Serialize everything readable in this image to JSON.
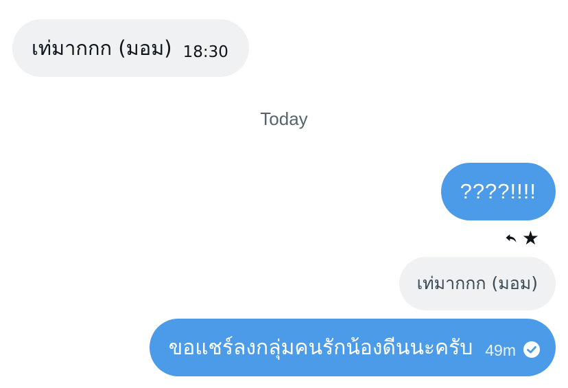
{
  "messages": {
    "incoming": {
      "text": "เท่มากกก (มอม)",
      "time": "18:30"
    },
    "date_divider": "Today",
    "outgoing_question": {
      "text": "????!!!!"
    },
    "reactions": {
      "reply_icon": "reply-icon",
      "star": "★"
    },
    "quote_preview": {
      "text": "เท่มากกก (มอม)"
    },
    "outgoing_main": {
      "text": "ขอแชร์ลงกลุ่มคนรักน้องดีนนะครับ",
      "time": "49m",
      "status_icon": "read-check-icon"
    }
  },
  "colors": {
    "outgoing_bubble": "#4c9be8",
    "incoming_bubble": "#eff1f3",
    "date_text": "#536471"
  }
}
